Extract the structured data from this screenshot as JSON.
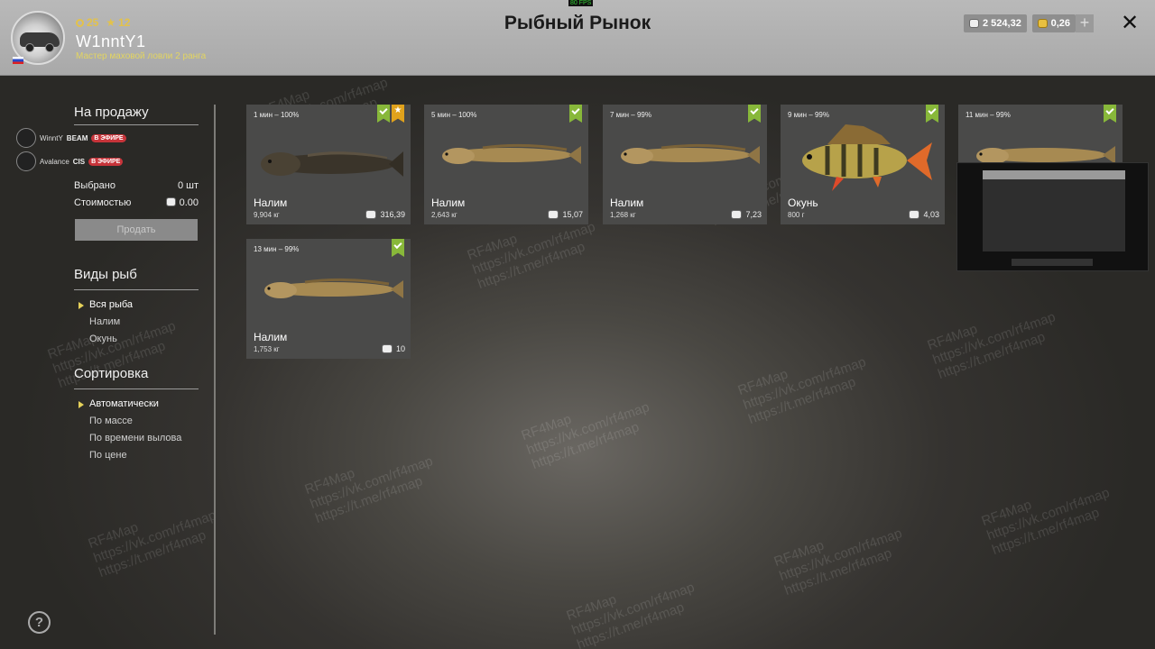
{
  "fps": "80 FPS",
  "header": {
    "title": "Рыбный Рынок",
    "player": {
      "nick": "W1nntY1",
      "rank_text": "Мастер маховой ловли 2 ранга",
      "level": "25",
      "stars": "12"
    },
    "currency": {
      "silver": "2 524,32",
      "gold": "0,26"
    },
    "plus_label": "+",
    "close_label": "✕"
  },
  "stream": [
    {
      "name": "WinntY",
      "platform": "BEAM",
      "live": "В ЭФИРЕ"
    },
    {
      "name": "Avalance",
      "platform": "CIS",
      "live": "В ЭФИРЕ"
    }
  ],
  "sidebar": {
    "for_sale": {
      "title": "На продажу",
      "selected_label": "Выбрано",
      "selected_value": "0 шт",
      "cost_label": "Стоимостью",
      "cost_value": "0.00",
      "sell_button": "Продать"
    },
    "species": {
      "title": "Виды рыб",
      "items": [
        "Вся рыба",
        "Налим",
        "Окунь"
      ],
      "active": 0
    },
    "sort": {
      "title": "Сортировка",
      "items": [
        "Автоматически",
        "По массе",
        "По времени вылова",
        "По цене"
      ],
      "active": 0
    }
  },
  "cards": [
    {
      "meta": "1 мин – 100%",
      "name": "Налим",
      "weight": "9,904 кг",
      "price": "316,39",
      "star": true,
      "fish": "burbot-dark"
    },
    {
      "meta": "5 мин – 100%",
      "name": "Налим",
      "weight": "2,643 кг",
      "price": "15,07",
      "star": false,
      "fish": "burbot"
    },
    {
      "meta": "7 мин – 99%",
      "name": "Налим",
      "weight": "1,268 кг",
      "price": "7,23",
      "star": false,
      "fish": "burbot"
    },
    {
      "meta": "9 мин – 99%",
      "name": "Окунь",
      "weight": "800 г",
      "price": "4,03",
      "star": false,
      "fish": "perch"
    },
    {
      "meta": "11 мин – 99%",
      "name": "",
      "weight": "",
      "price": "",
      "star": false,
      "fish": "burbot"
    },
    {
      "meta": "13 мин – 99%",
      "name": "Налим",
      "weight": "1,753 кг",
      "price": "10",
      "star": false,
      "fish": "burbot"
    }
  ],
  "watermark": [
    "RF4Map",
    "https://vk.com/rf4map",
    "https://t.me/rf4map"
  ],
  "help_label": "?"
}
